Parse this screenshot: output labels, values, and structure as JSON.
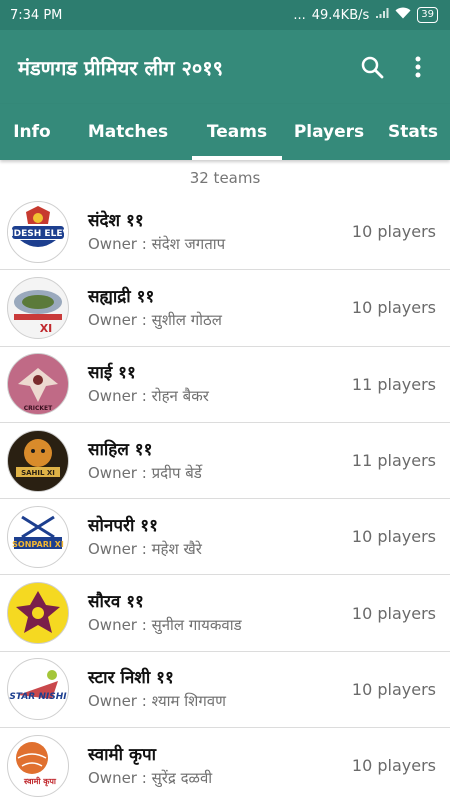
{
  "status": {
    "time": "7:34 PM",
    "dots": "...",
    "speed": "49.4KB/s",
    "battery": "39"
  },
  "app": {
    "title": "मंडणगड प्रीमियर लीग २०१९"
  },
  "tabs": [
    {
      "label": "Info"
    },
    {
      "label": "Matches"
    },
    {
      "label": "Teams"
    },
    {
      "label": "Players"
    },
    {
      "label": "Stats"
    }
  ],
  "team_count": "32 teams",
  "teams": [
    {
      "name": "संदेश ११",
      "owner": "Owner : संदेश जगताप",
      "players": "10 players",
      "logo_text": "SANDESH ELEVAN"
    },
    {
      "name": "सह्याद्री ११",
      "owner": "Owner : सुशील गोठल",
      "players": "10 players",
      "logo_text": "XI"
    },
    {
      "name": "साई ११",
      "owner": "Owner : रोहन बैकर",
      "players": "11 players",
      "logo_text": "CRICKET"
    },
    {
      "name": "साहिल ११",
      "owner": "Owner : प्रदीप बेर्डे",
      "players": "11 players",
      "logo_text": "SAHIL XI"
    },
    {
      "name": "सोनपरी ११",
      "owner": "Owner : महेश खैरे",
      "players": "10 players",
      "logo_text": "SONPARI XI"
    },
    {
      "name": "सौरव ११",
      "owner": "Owner : सुनील गायकवाड",
      "players": "10 players",
      "logo_text": ""
    },
    {
      "name": "स्टार निशी ११",
      "owner": "Owner : श्याम शिगवण",
      "players": "10 players",
      "logo_text": "STAR NISHI"
    },
    {
      "name": "स्वामी कृपा",
      "owner": "Owner : सुरेंद्र दळवी",
      "players": "10 players",
      "logo_text": "स्वामी कृपा"
    }
  ],
  "colors": {
    "primary": "#358a7a",
    "statusbar": "#2d7d6f"
  }
}
